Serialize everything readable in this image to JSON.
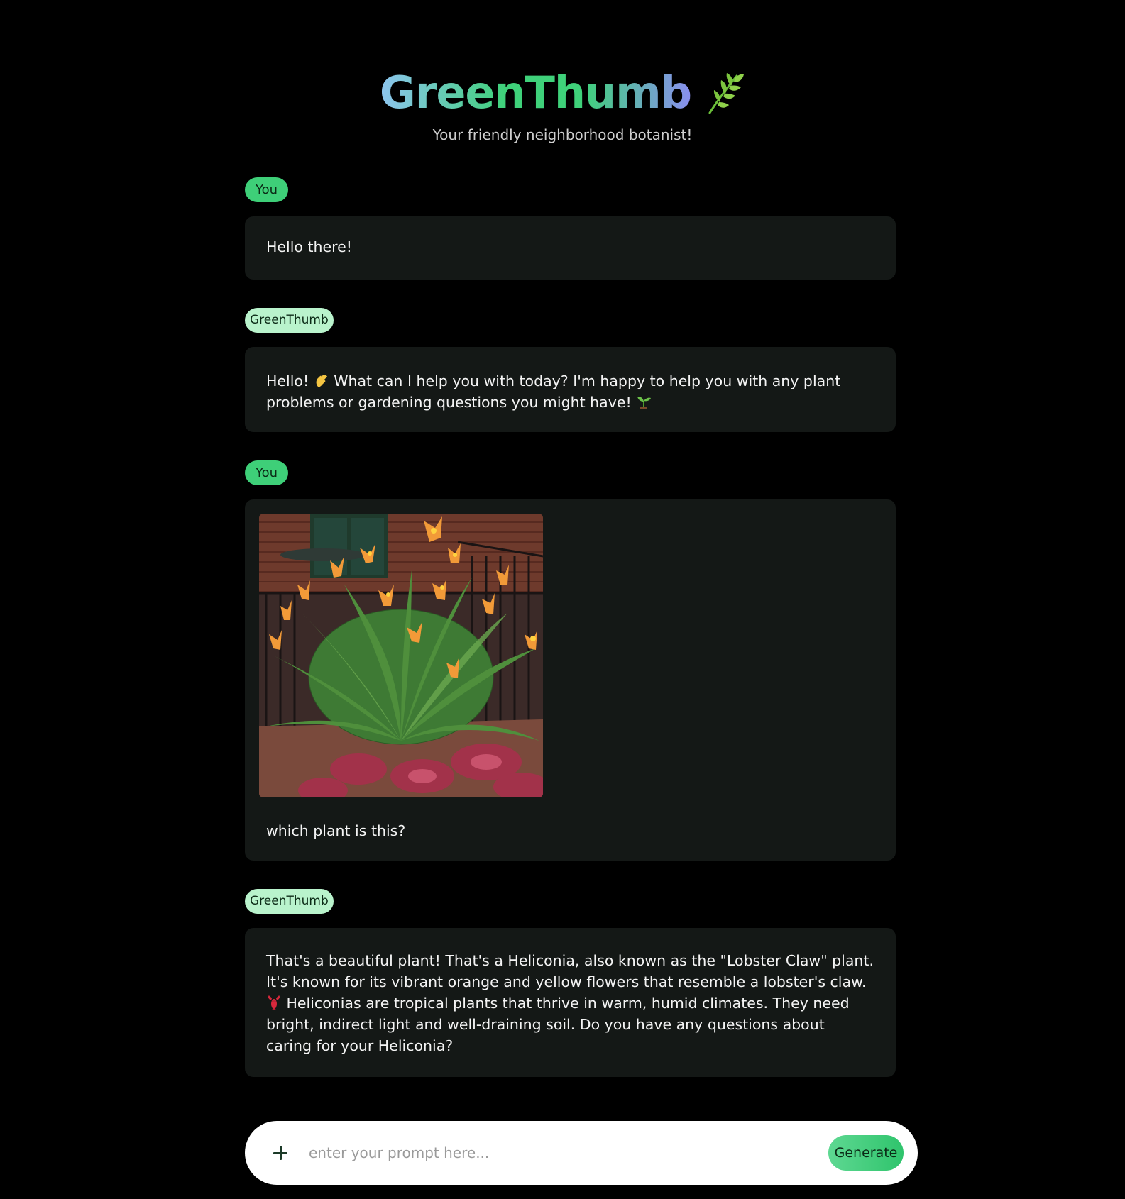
{
  "header": {
    "title": "GreenThumb",
    "title_icon": "leaf-icon",
    "subtitle": "Your friendly neighborhood botanist!"
  },
  "colors": {
    "background": "#000000",
    "bubble": "#141816",
    "user_badge": "#3ecf78",
    "bot_badge": "#b9f3cc",
    "accent": "#2fc46c"
  },
  "messages": [
    {
      "role_label": "You",
      "text": "Hello there!"
    },
    {
      "role_label": "GreenThumb",
      "text_part1": "Hello! ",
      "emoji1": "waving-hand-icon",
      "text_part2": " What can I help you with today? I'm happy to help you with any plant problems or gardening questions you might have! ",
      "emoji2": "seedling-icon"
    },
    {
      "role_label": "You",
      "image": "photo of flowering heliconia plant",
      "text": "which plant is this?"
    },
    {
      "role_label": "GreenThumb",
      "text_part1": "That's a beautiful plant! That's a Heliconia, also known as the \"Lobster Claw\" plant. It's known for its vibrant orange and yellow flowers that resemble a lobster's claw. ",
      "emoji1": "lobster-icon",
      "text_part2": " Heliconias are tropical plants that thrive in warm, humid climates. They need bright, indirect light and well-draining soil. Do you have any questions about caring for your Heliconia?"
    }
  ],
  "composer": {
    "placeholder": "enter your prompt here...",
    "add_icon": "plus-icon",
    "generate_label": "Generate"
  }
}
